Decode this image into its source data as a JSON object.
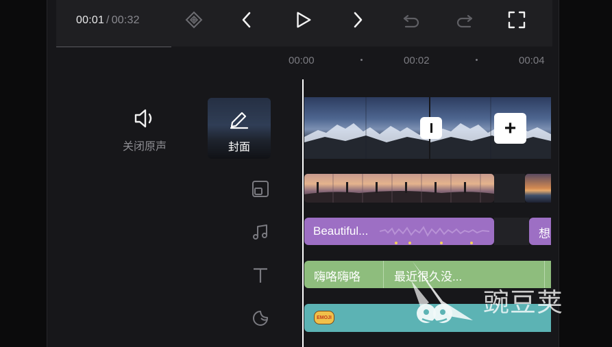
{
  "player": {
    "current_time": "00:01",
    "separator": "/",
    "total_time": "00:32"
  },
  "toolbar": {
    "icons": [
      "keyframe-icon",
      "previous-icon",
      "play-icon",
      "next-icon",
      "undo-icon",
      "redo-icon",
      "fullscreen-icon"
    ]
  },
  "ruler": {
    "labels": [
      "00:00",
      "00:02",
      "00:04"
    ]
  },
  "left_panel": {
    "mute_label": "关闭原声",
    "cover_label": "封面"
  },
  "tracks": {
    "audio_clip_label": "Beautiful...",
    "audio_clip2_label": "想",
    "text_clip1_label": "嗨咯嗨咯",
    "text_clip2_label": "最近很久没...",
    "sticker_label": "EMOJI"
  },
  "watermark": {
    "text": "豌豆荚"
  },
  "colors": {
    "audio_track": "#9d6fc4",
    "text_track": "#8ebd7d",
    "sticker_track": "#5cb3b4",
    "beat_marker": "#f2cf5a"
  }
}
